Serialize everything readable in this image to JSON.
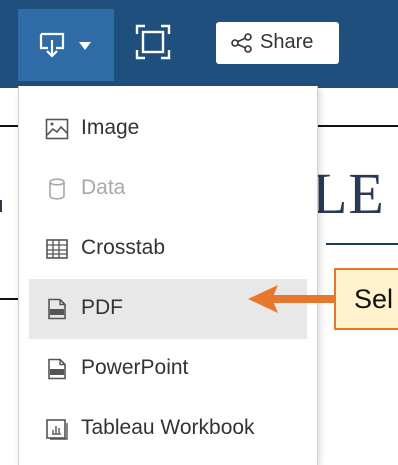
{
  "toolbar": {
    "download_icon": "download-icon",
    "fullscreen_icon": "fullscreen-icon",
    "share_label": "Share"
  },
  "menu": {
    "items": [
      {
        "label": "Image",
        "icon": "image-icon",
        "enabled": true
      },
      {
        "label": "Data",
        "icon": "database-icon",
        "enabled": false
      },
      {
        "label": "Crosstab",
        "icon": "table-icon",
        "enabled": true
      },
      {
        "label": "PDF",
        "icon": "pdf-icon",
        "enabled": true,
        "highlighted": true
      },
      {
        "label": "PowerPoint",
        "icon": "powerpoint-icon",
        "enabled": true
      },
      {
        "label": "Tableau Workbook",
        "icon": "workbook-icon",
        "enabled": true
      }
    ]
  },
  "callout": {
    "text": "Sel"
  },
  "background": {
    "text": "LE"
  },
  "colors": {
    "toolbar_bg": "#1f4f7d",
    "active_button": "#2f6ba6",
    "highlight": "#e8e8e8",
    "callout_border": "#e8772e",
    "callout_fill": "#fff2cc"
  }
}
